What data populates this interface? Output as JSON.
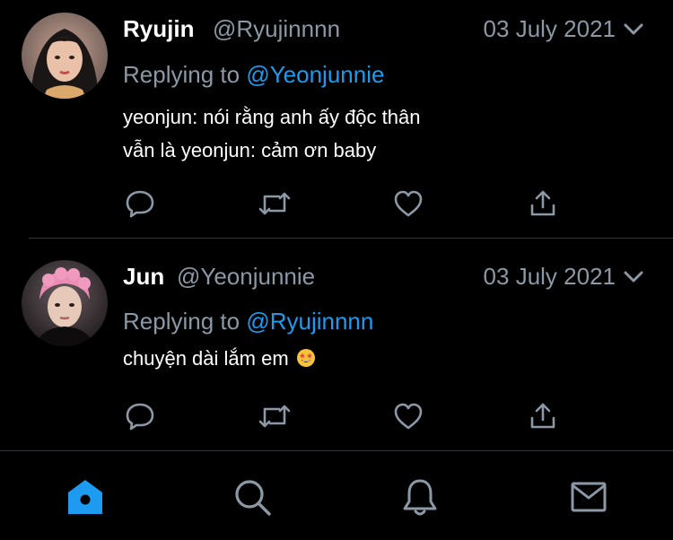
{
  "colors": {
    "background": "#000000",
    "text": "#ffffff",
    "muted": "#8b98a5",
    "accent": "#1d9bf0",
    "divider": "#2f3336"
  },
  "tweets": [
    {
      "name": "Ryujin",
      "handle": "@Ryujinnnn",
      "date": "03 July 2021",
      "replying_label": "Replying to",
      "replying_to": "@Yeonjunnie",
      "lines": [
        "yeonjun:  nói rằng anh ấy độc thân",
        "vẫn là yeonjun:  cảm ơn baby"
      ],
      "avatar_icon": "profile-photo"
    },
    {
      "name": "Jun",
      "handle": "@Yeonjunnie",
      "date": "03 July 2021",
      "replying_label": "Replying to",
      "replying_to": "@Ryujinnnn",
      "lines": [
        "chuyện dài lắm em"
      ],
      "line_emoji": "star-struck-emoji",
      "avatar_icon": "profile-photo"
    }
  ],
  "actions": [
    "reply-icon",
    "retweet-icon",
    "like-icon",
    "share-icon"
  ],
  "bottom_nav": {
    "items": [
      {
        "icon": "home-icon",
        "active": true
      },
      {
        "icon": "search-icon",
        "active": false
      },
      {
        "icon": "notifications-bell-icon",
        "active": false
      },
      {
        "icon": "messages-envelope-icon",
        "active": false
      }
    ]
  }
}
